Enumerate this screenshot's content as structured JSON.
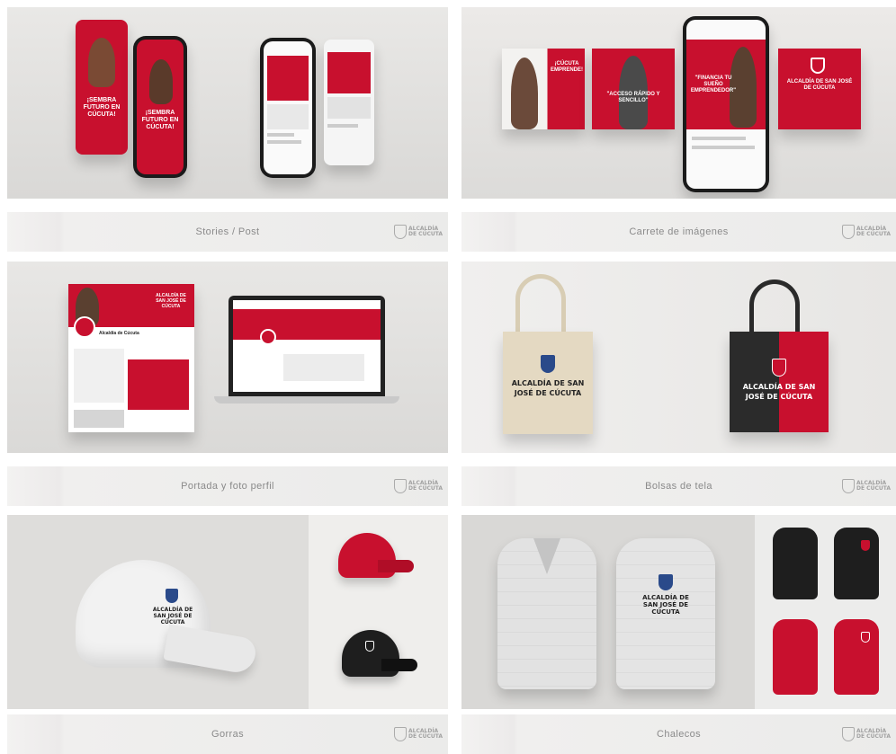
{
  "cards": [
    {
      "caption": "Stories / Post"
    },
    {
      "caption": "Carrete de imágenes"
    },
    {
      "caption": "Portada y foto perfil"
    },
    {
      "caption": "Bolsas de tela"
    },
    {
      "caption": "Gorras"
    },
    {
      "caption": "Chalecos"
    }
  ],
  "brand": {
    "logo_lines": [
      "ALCALDÍA",
      "DE SAN JOSÉ DE",
      "CÚCUTA"
    ],
    "colors": {
      "red": "#c8102e",
      "dark": "#1b1b1b",
      "light": "#e6e5e3"
    }
  },
  "mockups": {
    "stories": {
      "headline_1": "¡SEMBRA FUTURO EN CÚCUTA!",
      "headline_2": "¡SEMBRA FUTURO EN CÚCUTA!"
    },
    "carrete": {
      "slide_1": "¡CÚCUTA EMPRENDE!",
      "slide_2": "\"ACCESO RÁPIDO Y SENCILLO\"",
      "slide_3": "\"FINANCIA TU SUEÑO EMPRENDEDOR\"",
      "slide_4": "ALCALDÍA DE SAN JOSÉ DE CÚCUTA"
    },
    "portada": {
      "page_name": "Alcaldía de Cúcuta",
      "banner_logo": "ALCALDÍA DE SAN JOSÉ DE CÚCUTA"
    },
    "bolsas": {
      "bag_text": "ALCALDÍA DE SAN JOSÉ DE CÚCUTA"
    },
    "gorras": {
      "cap_text": "ALCALDÍA DE SAN JOSÉ DE CÚCUTA"
    },
    "chalecos": {
      "vest_text": "ALCALDÍA DE SAN JOSÉ DE CÚCUTA"
    }
  }
}
